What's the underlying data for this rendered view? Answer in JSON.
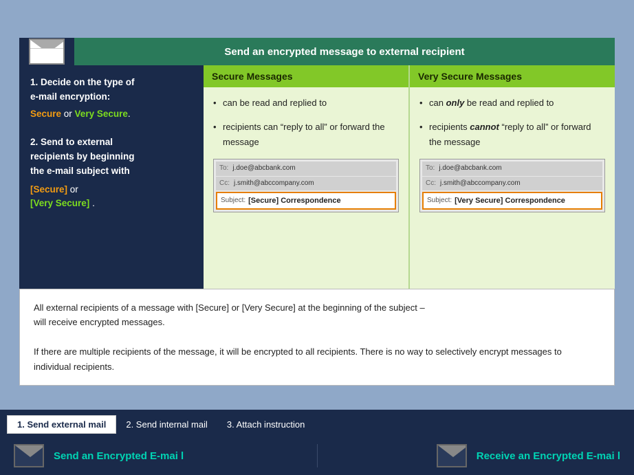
{
  "slide": {
    "header": "Send an encrypted message to external recipient",
    "left_panel": {
      "step1_title": "1. Decide on the type of e-mail encryption:",
      "step1_secure": "Secure",
      "step1_or": " or ",
      "step1_very_secure": "Very Secure",
      "step1_dot": ".",
      "step2_title": "2. Send to external recipients by beginning the e-mail subject with",
      "step2_secure_tag": "[Secure]",
      "step2_or": " or",
      "step2_very_secure_tag": "[Very Secure]",
      "step2_dot": " ."
    },
    "secure_col": {
      "header": "Secure Messages",
      "bullet1": "can be read and replied to",
      "bullet2_pre": "recipients can “reply to all” or forward the message",
      "to": "j.doe@abcbank.com",
      "cc": "j.smith@abccompany.com",
      "subject_label": "Subject:",
      "subject_value": "[Secure] Correspondence"
    },
    "very_secure_col": {
      "header": "Very Secure Messages",
      "bullet1_pre": "can ",
      "bullet1_bold": "only",
      "bullet1_post": " be read and replied to",
      "bullet2_pre": "recipients ",
      "bullet2_bold": "cannot",
      "bullet2_post": " “reply to all” or forward the message",
      "to": "j.doe@abcbank.com",
      "cc": "j.smith@abccompany.com",
      "subject_label": "Subject:",
      "subject_value": "[Very Secure] Correspondence"
    }
  },
  "info_box": {
    "line1": "All external recipients of a message with [Secure] or [Very Secure] at the beginning of the subject –",
    "line2": "will receive encrypted messages.",
    "line3": "If there are multiple recipients of the message, it will be encrypted to all recipients. There is no way to selectively encrypt messages to individual recipients."
  },
  "nav": {
    "tab1": "1.  Send  external mail",
    "tab2": "2.  Send internal mail",
    "tab3": "3.  Attach instruction",
    "label_left": "Send an Encrypted E-mai l",
    "label_right": "Receive an Encrypted E-mai l"
  }
}
